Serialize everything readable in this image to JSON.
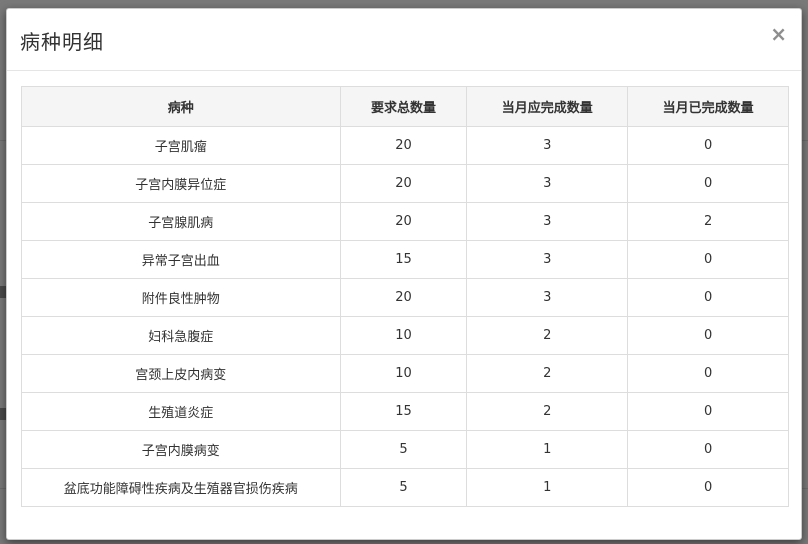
{
  "modal": {
    "title": "病种明细",
    "close_label": "×"
  },
  "table": {
    "headers": [
      "病种",
      "要求总数量",
      "当月应完成数量",
      "当月已完成数量"
    ],
    "rows": [
      [
        "子宫肌瘤",
        "20",
        "3",
        "0"
      ],
      [
        "子宫内膜异位症",
        "20",
        "3",
        "0"
      ],
      [
        "子宫腺肌病",
        "20",
        "3",
        "2"
      ],
      [
        "异常子宫出血",
        "15",
        "3",
        "0"
      ],
      [
        "附件良性肿物",
        "20",
        "3",
        "0"
      ],
      [
        "妇科急腹症",
        "10",
        "2",
        "0"
      ],
      [
        "宫颈上皮内病变",
        "10",
        "2",
        "0"
      ],
      [
        "生殖道炎症",
        "15",
        "2",
        "0"
      ],
      [
        "子宫内膜病变",
        "5",
        "1",
        "0"
      ],
      [
        "盆底功能障碍性疾病及生殖器官损伤疾病",
        "5",
        "1",
        "0"
      ]
    ]
  }
}
